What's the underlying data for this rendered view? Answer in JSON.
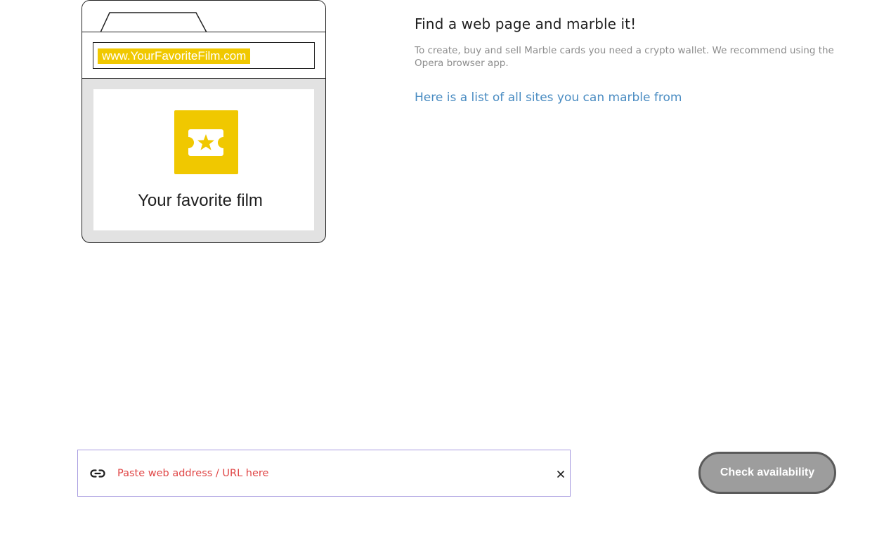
{
  "illustration": {
    "url_text": "www.YourFavoriteFilm.com",
    "film_title": "Your favorite film",
    "logo_icon": "ticket-star-icon",
    "accent_color": "#f0c800"
  },
  "intro": {
    "heading": "Find a web page and marble it!",
    "description": "To create, buy and sell Marble cards you need a crypto wallet. We recommend using the Opera browser app.",
    "sites_link": "Here is a list of all sites you can marble from",
    "link_color": "#4a8cc2"
  },
  "url_input": {
    "icon": "link-icon",
    "value": "",
    "placeholder": "Paste web address / URL here",
    "placeholder_color": "#e04646",
    "clear_icon": "close-icon",
    "clear_glyph": "✕"
  },
  "check_button": {
    "label": "Check availability"
  }
}
